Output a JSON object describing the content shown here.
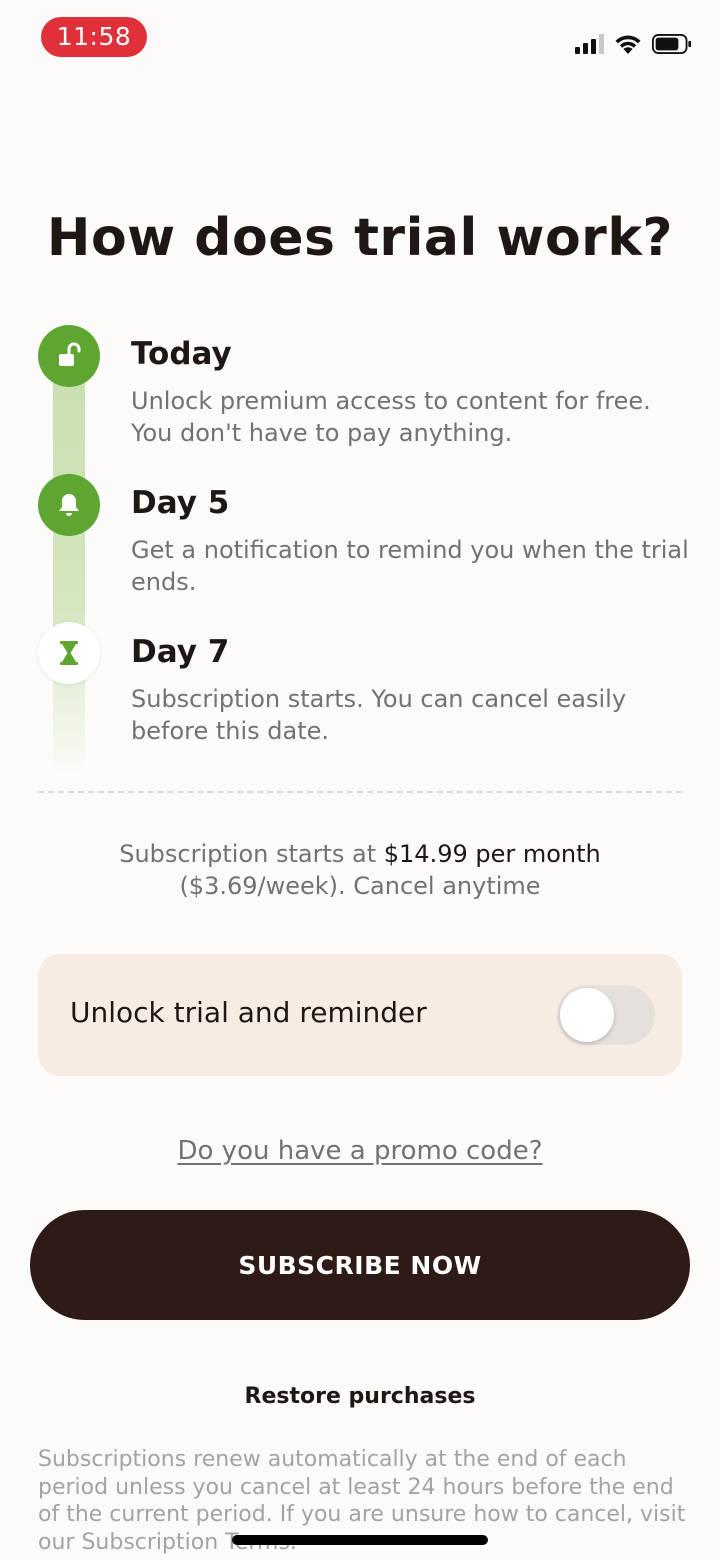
{
  "status_bar": {
    "time": "11:58",
    "icons": [
      "cellular-signal-icon",
      "wifi-icon",
      "battery-icon"
    ],
    "time_pill_color": "#e0313b"
  },
  "title": "How does trial work?",
  "timeline": [
    {
      "icon": "unlocked-padlock-icon",
      "title": "Today",
      "description": "Unlock premium access to content for free. You don't have to pay anything."
    },
    {
      "icon": "bell-icon",
      "title": "Day 5",
      "description": "Get a notification to remind you when the trial ends."
    },
    {
      "icon": "hourglass-icon",
      "title": "Day 7",
      "description": "Subscription starts. You can cancel easily before this date."
    }
  ],
  "pricing": {
    "prefix": "Subscription starts at ",
    "price": "$14.99 per month",
    "suffix": "($3.69/week). Cancel anytime"
  },
  "reminder_toggle": {
    "label": "Unlock trial and reminder",
    "enabled": false
  },
  "promo_link": "Do you have a promo code?",
  "subscribe_button": "SUBSCRIBE NOW",
  "restore_link": "Restore purchases",
  "legal_text": "Subscriptions renew automatically at the end of each period unless you cancel at least 24 hours before the end of the current period. If you are unsure how to cancel, visit our Subscription Terms.",
  "colors": {
    "accent_green": "#5fa532",
    "primary_button": "#2e1b18",
    "card_background": "#f7ece4",
    "page_background": "#fcfbf9"
  }
}
